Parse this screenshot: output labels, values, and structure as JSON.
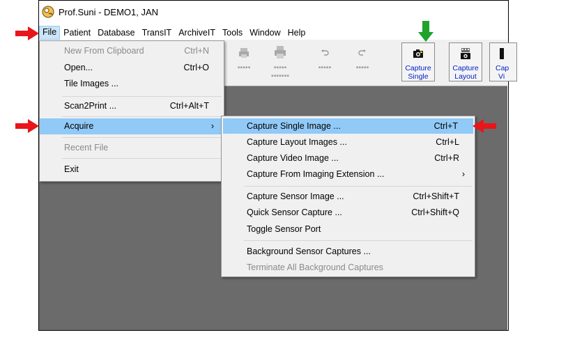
{
  "window": {
    "title": "Prof.Suni - DEMO1, JAN"
  },
  "menubar": [
    "File",
    "Patient",
    "Database",
    "TransIT",
    "ArchiveIT",
    "Tools",
    "Window",
    "Help"
  ],
  "toolbar": {
    "buttons": [
      {
        "label": "Print",
        "icon": "print-icon",
        "disabled": true
      },
      {
        "label": "Print Multiple",
        "icon": "print-multiple-icon",
        "disabled": true
      },
      {
        "label": "Undo",
        "icon": "undo-icon",
        "disabled": true
      },
      {
        "label": "Redo",
        "icon": "redo-icon",
        "disabled": true
      },
      {
        "line1": "Capture",
        "line2": "Single",
        "icon": "camera-icon"
      },
      {
        "line1": "Capture",
        "line2": "Layout",
        "icon": "camera-layout-icon"
      },
      {
        "line1": "Cap",
        "line2": "Vi",
        "icon": "camera-video-icon"
      }
    ]
  },
  "file_menu": {
    "items": [
      {
        "label": "New From Clipboard",
        "shortcut": "Ctrl+N",
        "disabled": true
      },
      {
        "label": "Open...",
        "shortcut": "Ctrl+O"
      },
      {
        "label": "Tile Images ...",
        "shortcut": ""
      },
      {
        "label": "Scan2Print ...",
        "shortcut": "Ctrl+Alt+T"
      },
      {
        "label": "Acquire",
        "shortcut": "›",
        "highlighted": true
      },
      {
        "label": "Recent File",
        "shortcut": "",
        "disabled": true
      },
      {
        "label": "Exit",
        "shortcut": ""
      }
    ]
  },
  "acquire_submenu": {
    "items": [
      {
        "label": "Capture Single Image ...",
        "shortcut": "Ctrl+T",
        "highlighted": true
      },
      {
        "label": "Capture Layout Images ...",
        "shortcut": "Ctrl+L"
      },
      {
        "label": "Capture Video Image ...",
        "shortcut": "Ctrl+R"
      },
      {
        "label": "Capture From Imaging Extension ...",
        "shortcut": "›"
      },
      {
        "label": "Capture Sensor Image ...",
        "shortcut": "Ctrl+Shift+T"
      },
      {
        "label": "Quick Sensor Capture ...",
        "shortcut": "Ctrl+Shift+Q"
      },
      {
        "label": "Toggle Sensor Port",
        "shortcut": ""
      },
      {
        "label": "Background Sensor Captures ...",
        "shortcut": ""
      },
      {
        "label": "Terminate All Background Captures",
        "shortcut": "",
        "disabled": true
      }
    ]
  },
  "colors": {
    "highlight": "#91c9f7",
    "workspace": "#6b6b6b",
    "annotation_red": "#e8151b",
    "annotation_green": "#1fa22e",
    "link_blue": "#0020c8"
  }
}
